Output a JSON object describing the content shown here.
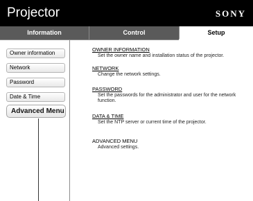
{
  "header": {
    "app_title": "Projector",
    "brand": "SONY"
  },
  "tabs": [
    {
      "label": "Information"
    },
    {
      "label": "Control"
    },
    {
      "label": "Setup"
    }
  ],
  "sidebar": {
    "items": [
      {
        "label": "Owner information"
      },
      {
        "label": "Network"
      },
      {
        "label": "Password"
      },
      {
        "label": "Date & Time"
      }
    ],
    "advanced": {
      "label": "Advanced Menu",
      "chevron": "»"
    }
  },
  "sections": [
    {
      "title": "OWNER INFORMATION",
      "desc": "Set the owner name and installation status of the projector."
    },
    {
      "title": "NETWORK",
      "desc": "Change the network settings."
    },
    {
      "title": "PASSWORD",
      "desc": "Set the passwords for the administrator and user for the network function."
    },
    {
      "title": "DATA & TIME",
      "desc": "Set the NTP server or current time of the projector."
    },
    {
      "title": "ADVANCED MENU",
      "desc": "Advanced settings."
    }
  ]
}
